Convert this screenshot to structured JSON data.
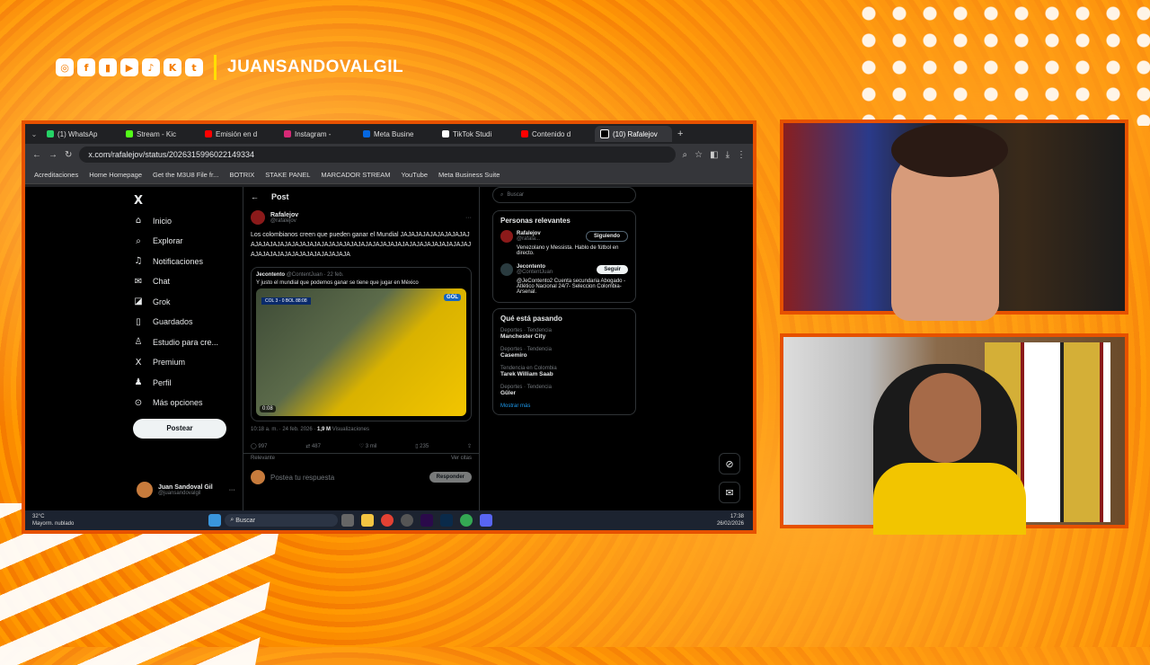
{
  "overlay": {
    "handle": "JUANSANDOVALGIL",
    "social_icons": [
      "instagram-icon",
      "facebook-icon",
      "twitch-icon",
      "youtube-icon",
      "tiktok-icon",
      "kick-icon",
      "twitter-icon"
    ]
  },
  "browser": {
    "tabs": [
      "(1) WhatsAp",
      "Stream - Kic",
      "Emisión en d",
      "Instagram -",
      "Meta Busine",
      "TikTok Studi",
      "Contenido d",
      "(10) Rafalejov"
    ],
    "url": "x.com/rafalejov/status/2026315996022149334",
    "bookmarks": [
      "Acreditaciones",
      "Home Homepage",
      "Get the M3U8 File fr...",
      "BOTRIX",
      "STAKE PANEL",
      "MARCADOR STREAM",
      "YouTube",
      "Meta Business Suite"
    ]
  },
  "x": {
    "nav": [
      "Inicio",
      "Explorar",
      "Notificaciones",
      "Chat",
      "Grok",
      "Guardados",
      "Estudio para cre...",
      "Premium",
      "Perfil",
      "Más opciones"
    ],
    "post_button": "Postear",
    "me_name": "Juan Sandoval Gil",
    "me_handle": "@juansandovalgil",
    "header": "Post",
    "author": "Rafalejov",
    "author_handle": "@rafalejov",
    "tweet_text": "Los colombianos creen que pueden ganar el Mundial JAJAJAJAJAJAJAJAJAJAJAJAJAJAJAJAJAJAJAJAJAJAJAJAJAJAJAJAJAJAJAJAJAJAJAJAJAJAJAJAJAJAJAJAJAJAJAJAJAJAJAJAJA",
    "quote_author": "Jecontento",
    "quote_handle": "@ContentJuan · 22 feb.",
    "quote_text": "Y justo el mundial que podemos ganar  se tiene que jugar en México",
    "score": "COL 3 - 0 BOL  88:08",
    "duration": "0:08",
    "meta": "10:18 a. m. · 24 feb. 2026 · ",
    "views": "1,9 M",
    "views_label": "Visualizaciones",
    "stats": [
      "997",
      "487",
      "3 mil",
      "235"
    ],
    "relevant": "Relevante",
    "see_quotes": "Ver citas",
    "reply_placeholder": "Postea tu respuesta",
    "reply_button": "Responder",
    "search_placeholder": "Buscar",
    "relevant_title": "Personas relevantes",
    "people": [
      {
        "name": "Rafalejov",
        "handle": "@rafala...",
        "btn": "Siguiendo",
        "bio": "Venezolano y Messista. Hablo de fútbol en directo."
      },
      {
        "name": "Jecontento",
        "handle": "@ContentJuan",
        "btn": "Seguir",
        "bio": "@JeContento2 Cuenta secundaria Abogado -Atlético Nacional 24/7- Seleccion Colombia- Arsenal."
      }
    ],
    "trending_title": "Qué está pasando",
    "trends": [
      {
        "cat": "Deportes · Tendencia",
        "name": "Manchester City"
      },
      {
        "cat": "Deportes · Tendencia",
        "name": "Casemiro"
      },
      {
        "cat": "Tendencia en Colombia",
        "name": "Tarek William Saab"
      },
      {
        "cat": "Deportes · Tendencia",
        "name": "Güler"
      }
    ],
    "show_more": "Mostrar más"
  },
  "taskbar": {
    "weather_temp": "32°C",
    "weather_desc": "Mayorm. nublado",
    "search": "Buscar",
    "time": "17:38",
    "date": "26/02/2026"
  },
  "colors": {
    "accent": "#e65100",
    "x_blue": "#1d9bf0"
  }
}
